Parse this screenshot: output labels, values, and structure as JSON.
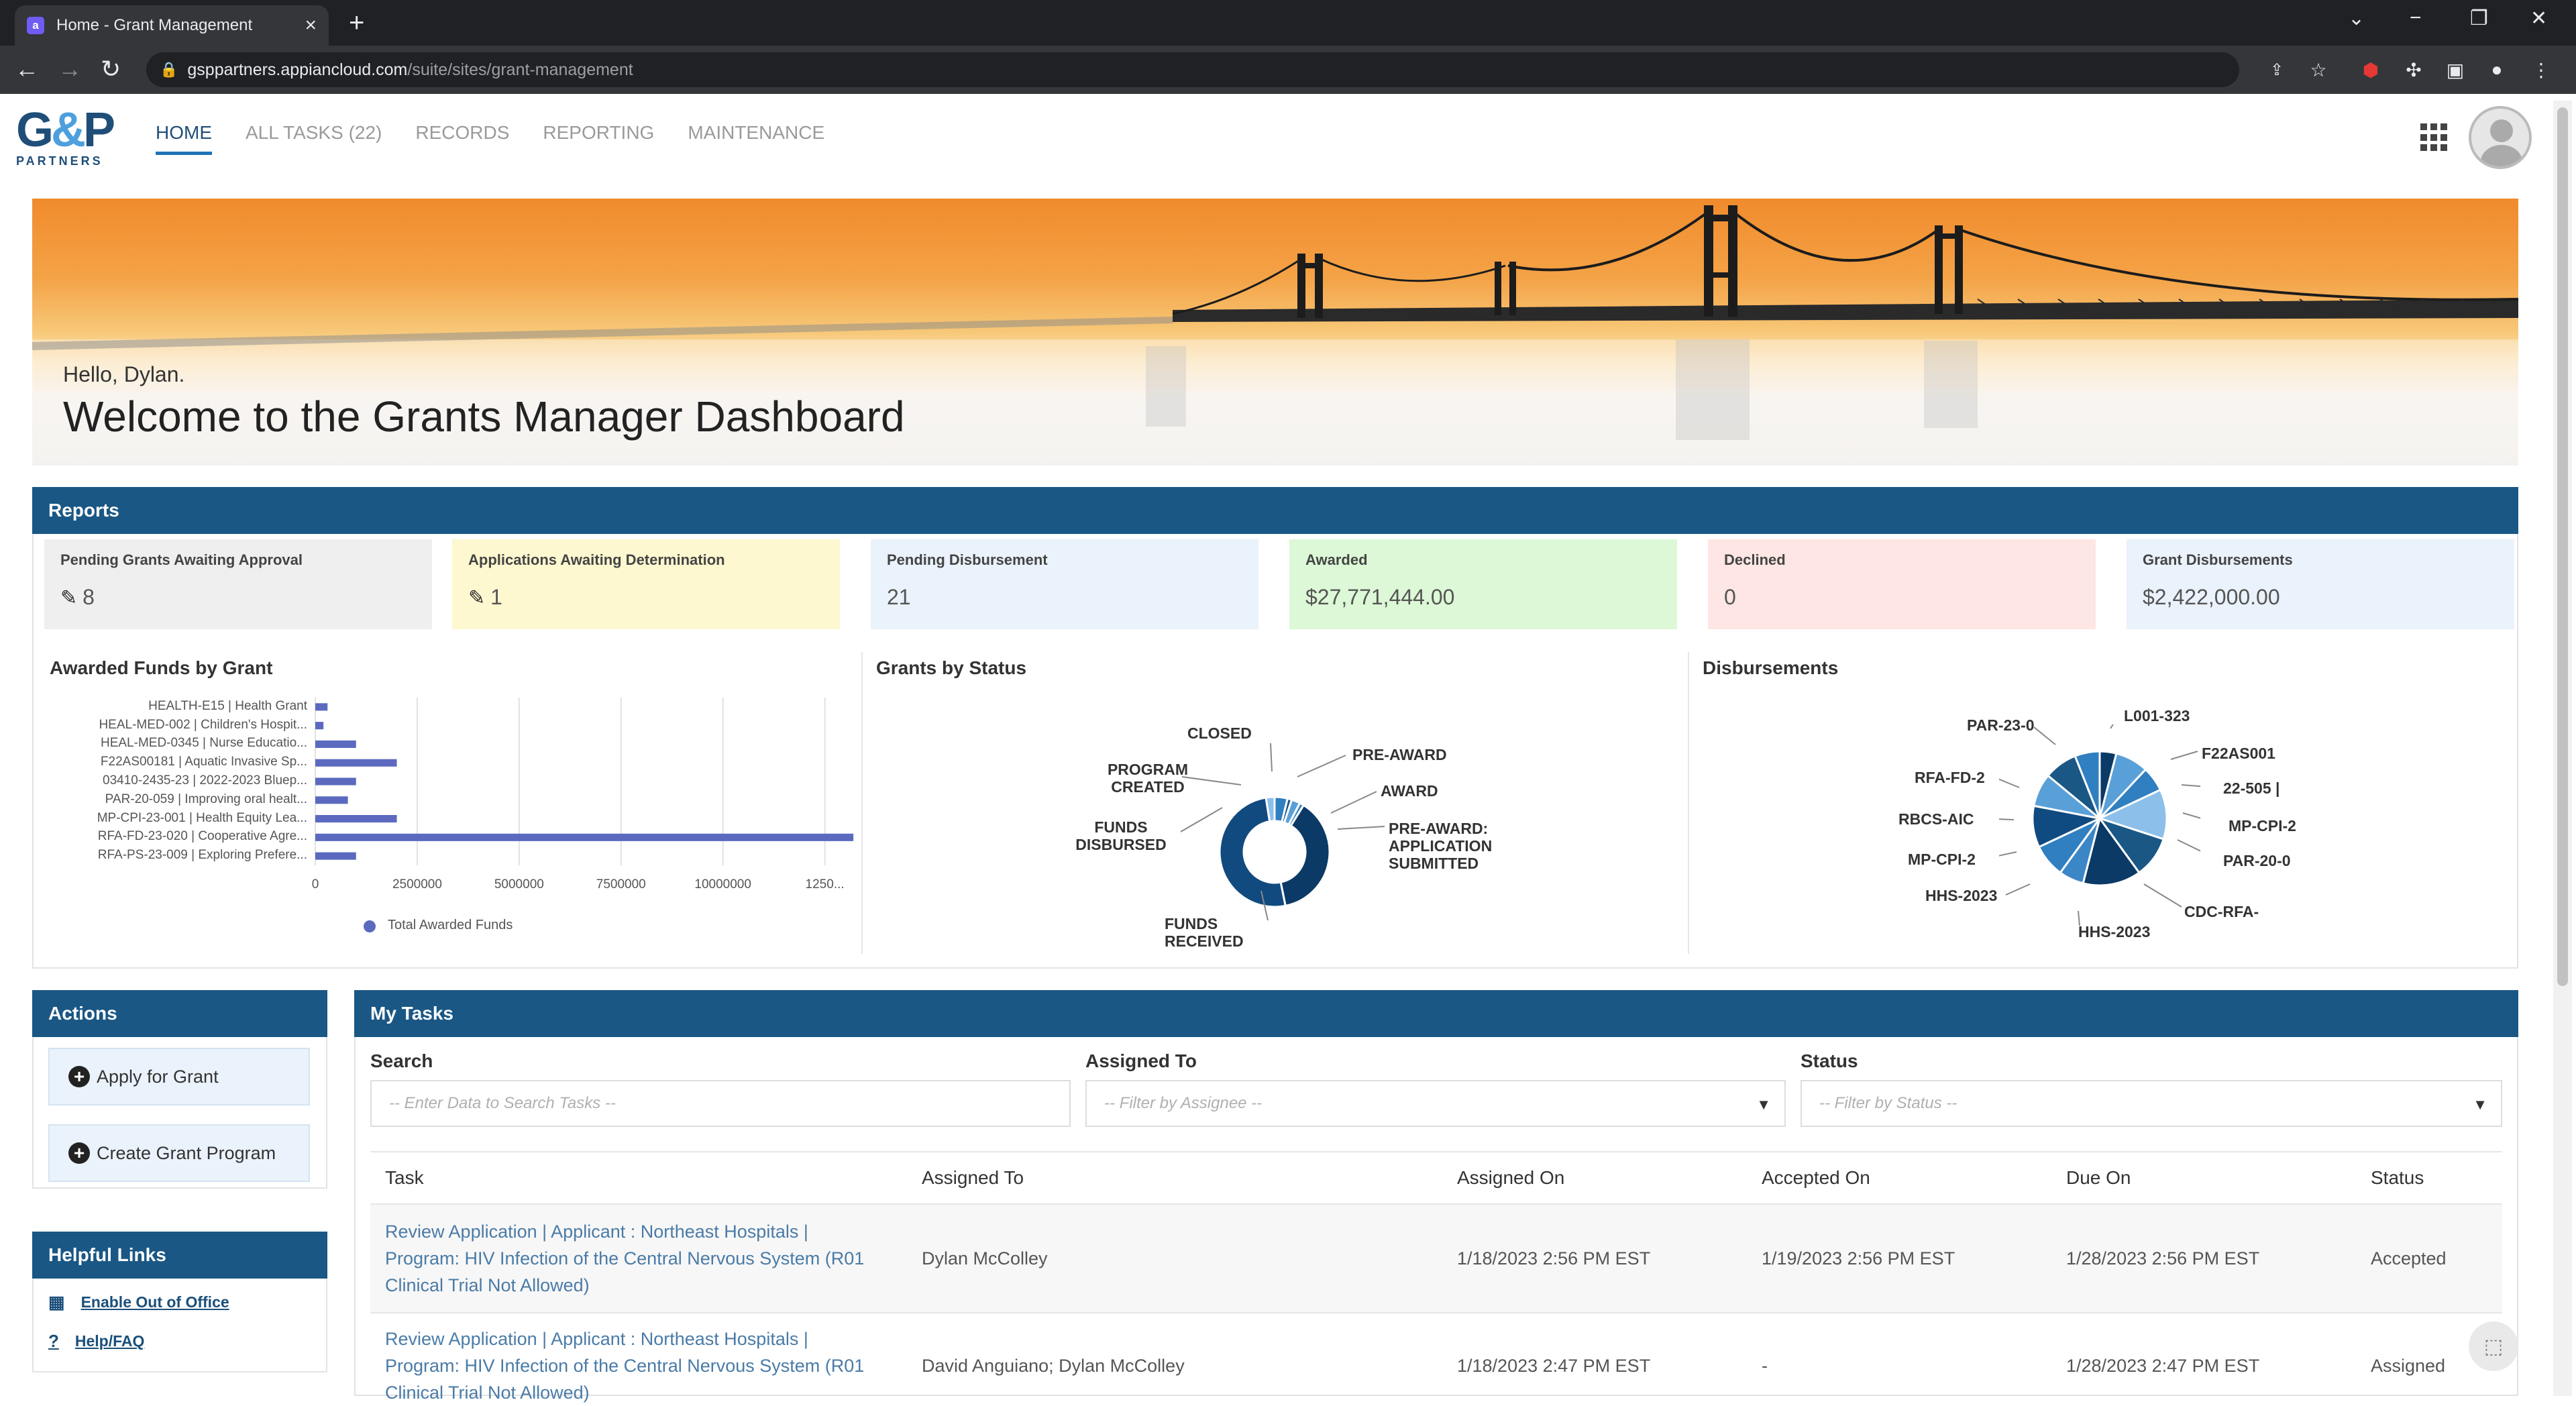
{
  "browser": {
    "tab_title": "Home - Grant Management",
    "favicon": "a",
    "url_host": "gsppartners.appiancloud.com",
    "url_path": "/suite/sites/grant-management"
  },
  "app": {
    "logo_text": "G&P",
    "logo_amp": "&",
    "logo_sub": "PARTNERS",
    "nav": [
      "HOME",
      "ALL TASKS (22)",
      "RECORDS",
      "REPORTING",
      "MAINTENANCE"
    ]
  },
  "banner": {
    "greeting": "Hello, Dylan.",
    "title": "Welcome to the Grants Manager Dashboard"
  },
  "reports": {
    "header": "Reports",
    "cards": [
      {
        "label": "Pending Grants Awaiting Approval",
        "value": "8",
        "icon": "pencil-icon",
        "bg": "#efefef"
      },
      {
        "label": "Applications Awaiting Determination",
        "value": "1",
        "icon": "pencil-icon",
        "bg": "#fdf8d0"
      },
      {
        "label": "Pending Disbursement",
        "value": "21",
        "icon": "",
        "bg": "#eaf2fb"
      },
      {
        "label": "Awarded",
        "value": "$27,771,444.00",
        "icon": "",
        "bg": "#dcf8d6"
      },
      {
        "label": "Declined",
        "value": "0",
        "icon": "",
        "bg": "#fde6e3"
      },
      {
        "label": "Grant Disbursements",
        "value": "$2,422,000.00",
        "icon": "",
        "bg": "#eaf2fb"
      }
    ],
    "awarded_title": "Awarded Funds by Grant",
    "status_title": "Grants by Status",
    "disb_title": "Disbursements"
  },
  "chart_data": [
    {
      "type": "bar",
      "orientation": "horizontal",
      "title": "Awarded Funds by Grant",
      "categories": [
        "HEALTH-E15 | Health Grant",
        "HEAL-MED-002 | Children's Hospit...",
        "HEAL-MED-0345 | Nurse Educatio...",
        "F22AS00181 | Aquatic Invasive Sp...",
        "03410-2435-23 | 2022-2023 Bluep...",
        "PAR-20-059 | Improving oral healt...",
        "MP-CPI-23-001 | Health Equity Lea...",
        "RFA-FD-23-020 | Cooperative Agre...",
        "RFA-PS-23-009 | Exploring Prefere..."
      ],
      "values": [
        300000,
        200000,
        1000000,
        2000000,
        1000000,
        800000,
        2000000,
        13200000,
        1000000
      ],
      "xticks": [
        "0",
        "2500000",
        "5000000",
        "7500000",
        "10000000",
        "1250..."
      ],
      "xlim": [
        0,
        13000000
      ],
      "legend": [
        "Total Awarded Funds"
      ],
      "legend_color": "#5b6abf",
      "grid": true
    },
    {
      "type": "pie",
      "variant": "donut",
      "title": "Grants by Status",
      "labels": [
        "CLOSED",
        "PRE-AWARD",
        "AWARD",
        "PRE-AWARD: APPLICATION SUBMITTED",
        "FUNDS RECEIVED",
        "FUNDS DISBURSED",
        "PROGRAM CREATED"
      ],
      "values": [
        3,
        1,
        2,
        1,
        30,
        40,
        2
      ],
      "colors": [
        "#2f7fc1",
        "#1a5784",
        "#5aa0d8",
        "#3b86c6",
        "#0b3a66",
        "#114a7e",
        "#8cc0ea"
      ]
    },
    {
      "type": "pie",
      "title": "Disbursements",
      "labels": [
        "L001-323",
        "F22AS001",
        "22-505 |",
        "MP-CPI-2",
        "PAR-20-0",
        "CDC-RFA-",
        "HHS-2023",
        "HHS-2023",
        "MP-CPI-2",
        "RBCS-AIC",
        "RFA-FD-2",
        "PAR-23-0"
      ],
      "values": [
        4,
        8,
        6,
        12,
        10,
        14,
        6,
        8,
        10,
        8,
        8,
        6
      ],
      "colors": [
        "#0b3a66",
        "#5aa0d8",
        "#2f7fc1",
        "#8cc0ea",
        "#1a5784",
        "#0b3a66",
        "#3b86c6",
        "#2f7fc1",
        "#0f4a80",
        "#5aa0d8",
        "#1a5784",
        "#2f7fc1"
      ]
    }
  ],
  "actions": {
    "header": "Actions",
    "buttons": [
      "Apply for Grant",
      "Create Grant Program"
    ]
  },
  "helpful_links": {
    "header": "Helpful Links",
    "links": [
      "Enable Out of Office",
      "Help/FAQ"
    ]
  },
  "tasks": {
    "header": "My Tasks",
    "search_label": "Search",
    "search_placeholder": "-- Enter Data to Search Tasks --",
    "assigned_label": "Assigned To",
    "assigned_placeholder": "-- Filter by Assignee --",
    "status_label": "Status",
    "status_placeholder": "-- Filter by Status --",
    "columns": [
      "Task",
      "Assigned To",
      "Assigned On",
      "Accepted On",
      "Due On",
      "Status"
    ],
    "rows": [
      {
        "task": "Review Application | Applicant : Northeast Hospitals | Program: HIV Infection of the Central Nervous System (R01 Clinical Trial Not Allowed)",
        "assigned_to": "Dylan McColley",
        "assigned_on": "1/18/2023 2:56 PM EST",
        "accepted_on": "1/19/2023 2:56 PM EST",
        "due_on": "1/28/2023 2:56 PM EST",
        "status": "Accepted"
      },
      {
        "task": "Review Application | Applicant : Northeast Hospitals | Program: HIV Infection of the Central Nervous System (R01 Clinical Trial Not Allowed)",
        "assigned_to": "David Anguiano; Dylan McColley",
        "assigned_on": "1/18/2023 2:47 PM EST",
        "accepted_on": "-",
        "due_on": "1/28/2023 2:47 PM EST",
        "status": "Assigned"
      }
    ]
  }
}
